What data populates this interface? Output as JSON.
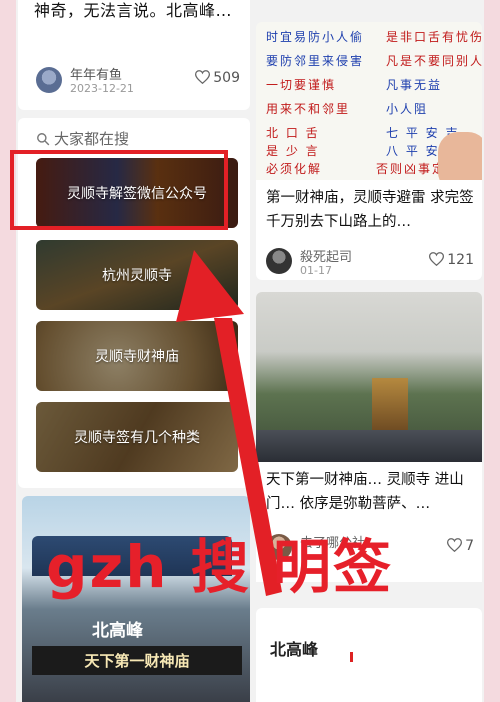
{
  "left_top_post": {
    "snippet": "神奇，无法言说。北高峰…",
    "author": "年年有鱼",
    "date": "2023-12-21",
    "likes": "509"
  },
  "search": {
    "heading": "大家都在搜",
    "suggestions": [
      "灵顺寺解签微信公众号",
      "杭州灵顺寺",
      "灵顺寺财神庙",
      "灵顺寺签有几个种类"
    ]
  },
  "left_bottom_image": {
    "plaque": "北高峰",
    "caption": "天下第一财神庙"
  },
  "right_post1": {
    "image_lines": [
      "时宜易防小人偷",
      "是非口舌有忧伤",
      "要防邻里来侵害",
      "凡是不要同别人",
      "一切要谨慎",
      "凡事无益",
      "用来不和邻里",
      "小人阻",
      "北 口 舌",
      "七 平 安 吉",
      "是 少 言",
      "八 平 安 吉",
      "必须化解",
      "否则凶事定"
    ],
    "title": "第一财神庙，灵顺寺避雷 求完签千万别去下山路上的…",
    "author": "殺死起司",
    "date": "01-17",
    "likes": "121"
  },
  "right_post2": {
    "title": "天下第一财神庙… 灵顺寺 进山门… 依序是弥勒菩萨、…",
    "author": "去了哪公社",
    "likes": "7"
  },
  "right_post3": {
    "title": "北高峰"
  },
  "overlay": {
    "banner": "gzh 搜 明签"
  },
  "colors": {
    "highlight": "#e32026",
    "arrow": "#e32026"
  }
}
